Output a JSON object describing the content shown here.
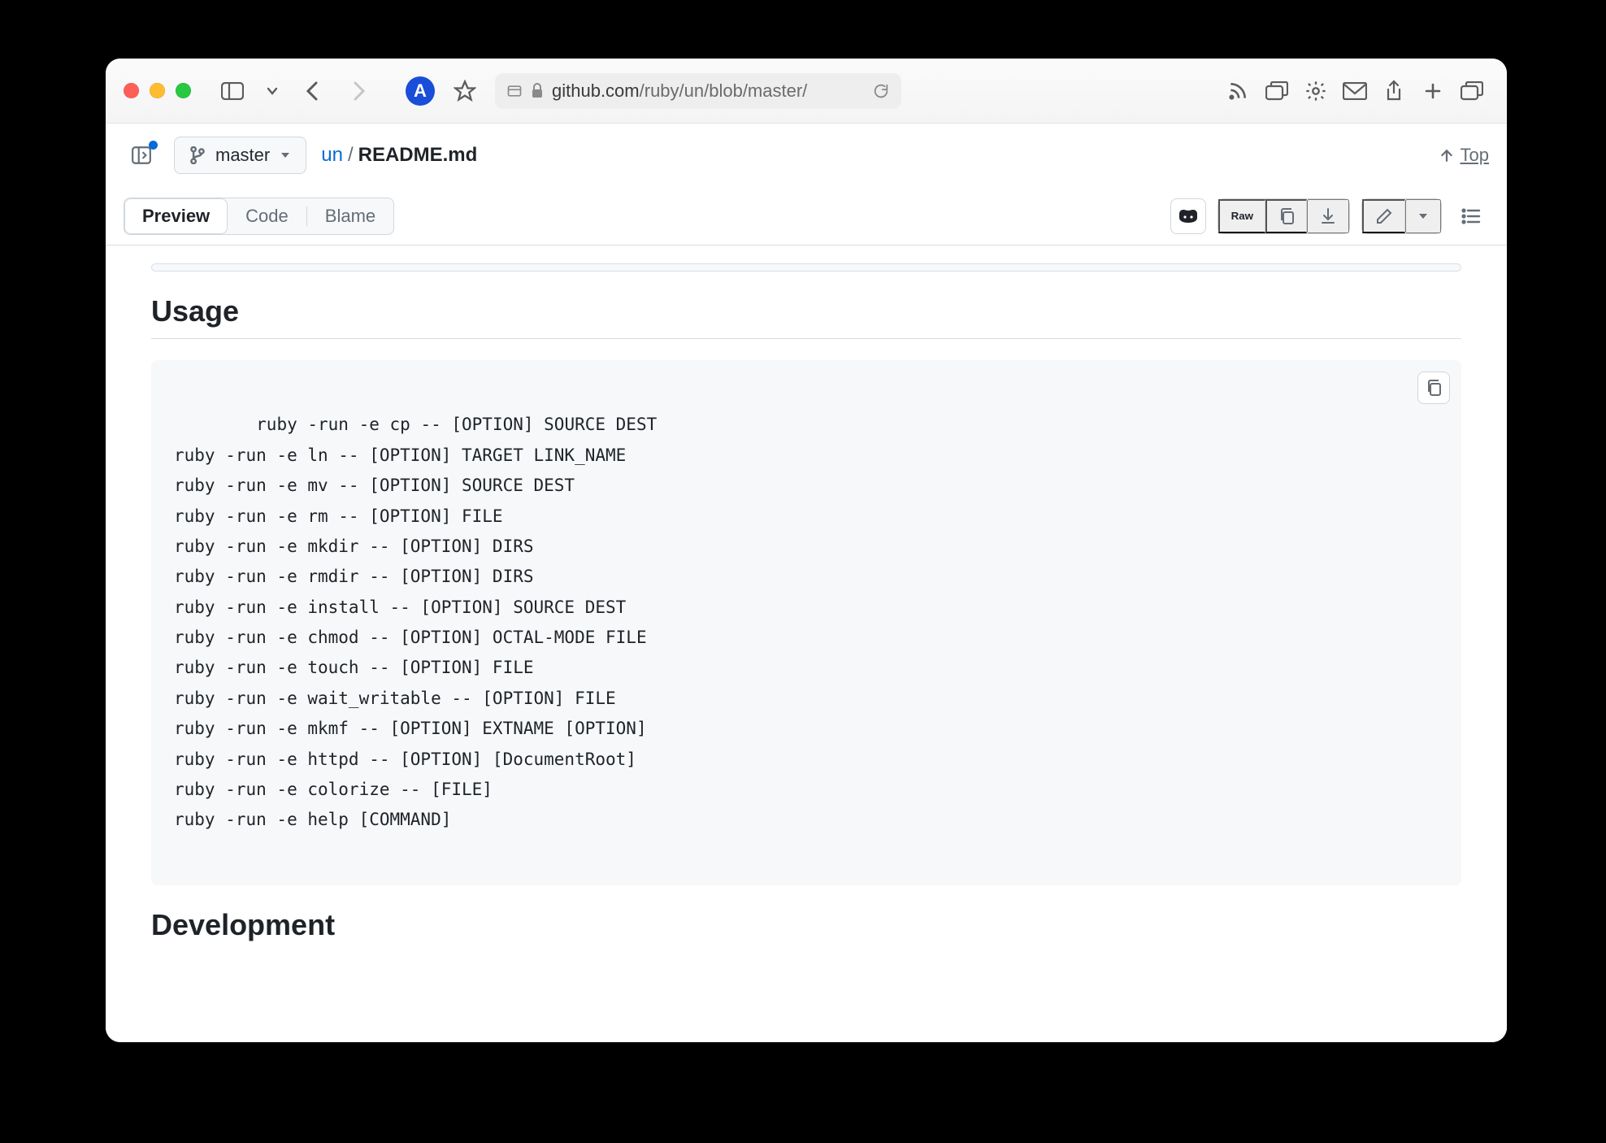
{
  "browser": {
    "profile_letter": "A",
    "url_host": "github.com",
    "url_path": "/ruby/un/blob/master/"
  },
  "repo": {
    "branch": "master",
    "breadcrumb_root": "un",
    "breadcrumb_file": "README.md",
    "top_label": "Top"
  },
  "tabs": {
    "preview": "Preview",
    "code": "Code",
    "blame": "Blame",
    "raw": "Raw"
  },
  "readme": {
    "h_usage": "Usage",
    "h_dev": "Development",
    "code_lines": [
      "ruby -run -e cp -- [OPTION] SOURCE DEST",
      "ruby -run -e ln -- [OPTION] TARGET LINK_NAME",
      "ruby -run -e mv -- [OPTION] SOURCE DEST",
      "ruby -run -e rm -- [OPTION] FILE",
      "ruby -run -e mkdir -- [OPTION] DIRS",
      "ruby -run -e rmdir -- [OPTION] DIRS",
      "ruby -run -e install -- [OPTION] SOURCE DEST",
      "ruby -run -e chmod -- [OPTION] OCTAL-MODE FILE",
      "ruby -run -e touch -- [OPTION] FILE",
      "ruby -run -e wait_writable -- [OPTION] FILE",
      "ruby -run -e mkmf -- [OPTION] EXTNAME [OPTION]",
      "ruby -run -e httpd -- [OPTION] [DocumentRoot]",
      "ruby -run -e colorize -- [FILE]",
      "ruby -run -e help [COMMAND]"
    ]
  }
}
